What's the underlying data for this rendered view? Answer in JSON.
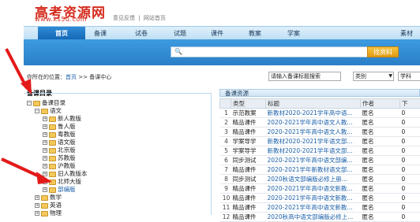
{
  "header": {
    "logo_text": "高考资源网",
    "logo_url": "www.ks5u.com",
    "top_links": [
      "意见反馈",
      "|",
      "网站首页"
    ]
  },
  "nav": {
    "items": [
      "首页",
      "备课",
      "试卷",
      "试题",
      "课件",
      "教案",
      "学案",
      "素材"
    ]
  },
  "search": {
    "placeholder": "",
    "button": "找资料"
  },
  "location": {
    "label": "你所在的位置：",
    "home": "首页",
    "sep": ">>",
    "current": "备课中心"
  },
  "filters": {
    "search_title": "请输入备课标题搜索",
    "category": "类别",
    "subject": "学科"
  },
  "left": {
    "title": "备课目录",
    "root": "备课目录",
    "chinese": "语文",
    "chinese_children": [
      "新人教版",
      "鲁人版",
      "粤教版",
      "语文版",
      "北京版",
      "苏教版",
      "沪教版",
      "旧人教版本",
      "北师大版",
      "部编版"
    ],
    "others": [
      "数学",
      "英语",
      "物理"
    ]
  },
  "right": {
    "title": "备课资源",
    "columns": [
      "",
      "类型",
      "标题",
      "作者",
      "下"
    ],
    "rows": [
      [
        "1",
        "示范教案",
        "新教材2020-2021学年高中语...",
        "匿名",
        "0"
      ],
      [
        "2",
        "精品课件",
        "2020-2021学年高中语文人教...",
        "匿名",
        "0"
      ],
      [
        "3",
        "精品课件",
        "2020-2021学年高中语文人教...",
        "匿名",
        "0"
      ],
      [
        "4",
        "学案导学",
        "新教材2020-2021学年语文部...",
        "匿名",
        "0"
      ],
      [
        "5",
        "学案导学",
        "新教材2020-2021学年语文部...",
        "匿名",
        "0"
      ],
      [
        "6",
        "同步测试",
        "2020-2021学年高中语文部编...",
        "匿名",
        "0"
      ],
      [
        "7",
        "精品课件",
        "2020-2021学年新教材语文部...",
        "匿名",
        "0"
      ],
      [
        "8",
        "同步测试",
        "2020秋语文部编版必修上册...",
        "匿名",
        "0"
      ],
      [
        "9",
        "精品课件",
        "2020-2021学年高中语文新教...",
        "匿名",
        "0"
      ],
      [
        "10",
        "精品课件",
        "2020-2021学年高中语文新教...",
        "匿名",
        "0"
      ],
      [
        "11",
        "精品课件",
        "2020-2021学年高中语文新教...",
        "匿名",
        "0"
      ],
      [
        "12",
        "精品课件",
        "2020秋高中语文部编版必修上...",
        "匿名",
        "0"
      ]
    ]
  },
  "colors": {
    "accent_blue": "#2a7fc7",
    "logo_red": "#d52b1e",
    "button_orange": "#e29a12",
    "arrow_red": "#e41a1a"
  }
}
